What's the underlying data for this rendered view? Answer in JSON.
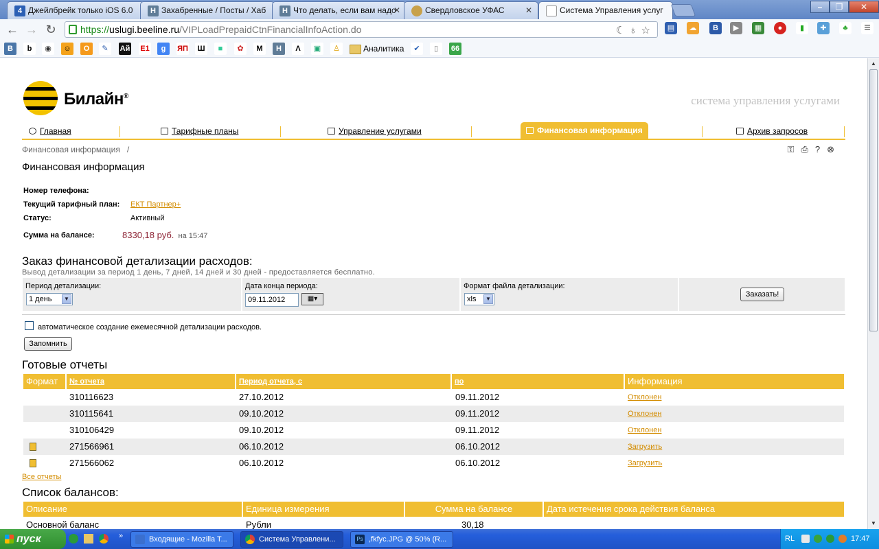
{
  "browser": {
    "tabs": [
      {
        "title": "Джейлбрейк только iOS 6.0",
        "icon": "letter-icon",
        "glyph": "4",
        "color": "#2b5fb4"
      },
      {
        "title": "Захабренные / Посты / Хаб",
        "icon": "habr-icon",
        "glyph": "H",
        "color": "#5f7c97"
      },
      {
        "title": "Что делать, если вам надо",
        "icon": "habr-icon",
        "glyph": "H",
        "color": "#5f7c97"
      },
      {
        "title": "Свердловское УФАС",
        "icon": "emblem-icon",
        "glyph": "",
        "color": "#c8a14a"
      },
      {
        "title": "Система Управления услуг",
        "icon": "page-icon",
        "glyph": "",
        "color": "#ffffff"
      }
    ],
    "url": {
      "scheme": "https://",
      "host": "uslugi.beeline.ru",
      "path": "/VIPLoadPrepaidCtnFinancialInfoAction.do"
    },
    "bookmarks": [
      {
        "icon": "vk-icon",
        "glyph": "В",
        "color": "#4a76a8",
        "text": "#fff"
      },
      {
        "icon": "b-icon",
        "glyph": "b",
        "color": "#ffffff",
        "text": "#000"
      },
      {
        "icon": "mask-icon",
        "glyph": "◉",
        "color": "#ffffff",
        "text": "#333"
      },
      {
        "icon": "smile-icon",
        "glyph": "☺",
        "color": "#f4a21b",
        "text": "#000"
      },
      {
        "icon": "odnoklassniki-icon",
        "glyph": "О",
        "color": "#f59a1c",
        "text": "#fff"
      },
      {
        "icon": "pen-icon",
        "glyph": "✎",
        "color": "#ffffff",
        "text": "#2f5fb0"
      },
      {
        "icon": "ai-icon",
        "glyph": "Ай",
        "color": "#111111",
        "text": "#fff"
      },
      {
        "icon": "e1-icon",
        "glyph": "E1",
        "color": "#ffffff",
        "text": "#d00"
      },
      {
        "icon": "google-icon",
        "glyph": "g",
        "color": "#4285f4",
        "text": "#fff"
      },
      {
        "icon": "yap-icon",
        "glyph": "ЯП",
        "color": "#ffffff",
        "text": "#c00"
      },
      {
        "icon": "columns-icon",
        "glyph": "Ш",
        "color": "#ffffff",
        "text": "#000"
      },
      {
        "icon": "square-icon",
        "glyph": "■",
        "color": "#ffffff",
        "text": "#3c9"
      },
      {
        "icon": "flower-icon",
        "glyph": "✿",
        "color": "#ffffff",
        "text": "#c22"
      },
      {
        "icon": "m-icon",
        "glyph": "M",
        "color": "#ffffff",
        "text": "#000"
      },
      {
        "icon": "habr-icon",
        "glyph": "H",
        "color": "#5f7c97",
        "text": "#fff"
      },
      {
        "icon": "lambda-icon",
        "glyph": "Λ",
        "color": "#ffffff",
        "text": "#000"
      },
      {
        "icon": "cube-icon",
        "glyph": "▣",
        "color": "#ffffff",
        "text": "#2a7"
      },
      {
        "icon": "person-icon",
        "glyph": "♙",
        "color": "#ffffff",
        "text": "#e0a000"
      }
    ],
    "bookmark_folder": "Аналитика",
    "bookmarks_after": [
      {
        "icon": "check-icon",
        "glyph": "✔",
        "color": "#ffffff",
        "text": "#2a62b7"
      },
      {
        "icon": "doc-icon",
        "glyph": "▯",
        "color": "#ffffff",
        "text": "#777"
      },
      {
        "icon": "sixsix-icon",
        "glyph": "66",
        "color": "#3aa64a",
        "text": "#fff"
      }
    ]
  },
  "site": {
    "brand": "Билайн",
    "brand_mark": "®",
    "tagline": "система управления услугами",
    "nav": [
      {
        "label": "Главная",
        "icon": "home-icon"
      },
      {
        "label": "Тарифные планы",
        "icon": "tariff-icon"
      },
      {
        "label": "Управление услугами",
        "icon": "services-icon"
      },
      {
        "label": "Финансовая информация",
        "icon": "finance-icon",
        "active": true
      },
      {
        "label": "Архив запросов",
        "icon": "archive-icon"
      }
    ],
    "breadcrumb": "Финансовая информация   /",
    "page_title": "Финансовая информация"
  },
  "account": {
    "phone_label": "Номер телефона:",
    "phone_value": "",
    "tariff_label": "Текущий тарифный план:",
    "tariff_value": "ЕКТ Партнер+",
    "status_label": "Статус:",
    "status_value": "Активный",
    "balance_label": "Сумма на балансе:",
    "balance_value": "8330,18 руб.",
    "balance_time": "на 15:47"
  },
  "order": {
    "title": "Заказ финансовой детализации расходов:",
    "note": "Вывод детализации за период 1 день, 7 дней, 14 дней и 30 дней - предоставляется бесплатно.",
    "period_label": "Период детализации:",
    "period_value": "1 день",
    "end_date_label": "Дата конца периода:",
    "end_date_value": "09.11.2012",
    "format_label": "Формат файла детализации:",
    "format_value": "xls",
    "order_button": "Заказать!",
    "auto_label": "автоматическое создание ежемесячной детализации расходов.",
    "remember_button": "Запомнить"
  },
  "reports": {
    "title": "Готовые отчеты",
    "columns": [
      "Формат",
      "№ отчета",
      "Период отчета, с",
      "по",
      "Информация"
    ],
    "rows": [
      {
        "number": "310116623",
        "from": "27.10.2012",
        "to": "09.11.2012",
        "info": "Отклонен",
        "has_file": false
      },
      {
        "number": "310115641",
        "from": "09.10.2012",
        "to": "09.11.2012",
        "info": "Отклонен",
        "has_file": false
      },
      {
        "number": "310106429",
        "from": "09.10.2012",
        "to": "09.11.2012",
        "info": "Отклонен",
        "has_file": false
      },
      {
        "number": "271566961",
        "from": "06.10.2012",
        "to": "06.10.2012",
        "info": "Загрузить",
        "has_file": true
      },
      {
        "number": "271566062",
        "from": "06.10.2012",
        "to": "06.10.2012",
        "info": "Загрузить",
        "has_file": true
      }
    ],
    "all_link": "Все отчеты"
  },
  "balances": {
    "title": "Список балансов:",
    "columns": [
      "Описание",
      "Единица измерения",
      "Сумма на балансе",
      "Дата истечения срока действия баланса"
    ],
    "rows": [
      {
        "description": "Основной баланс",
        "unit": "Рубли",
        "amount": "30,18",
        "expires": ""
      }
    ]
  },
  "taskbar": {
    "start": "пуск",
    "windows": [
      {
        "title": "Входящие - Mozilla T...",
        "icon": "thunderbird-icon",
        "color": "#3a6fcf"
      },
      {
        "title": "Система Управлени...",
        "icon": "chrome-icon",
        "color": "#e0a43a",
        "active": true
      },
      {
        "title": ",fkfyc.JPG @ 50% (R...",
        "icon": "photoshop-icon",
        "color": "#0b2a55"
      }
    ],
    "lang": "RL",
    "clock": "17:47"
  }
}
